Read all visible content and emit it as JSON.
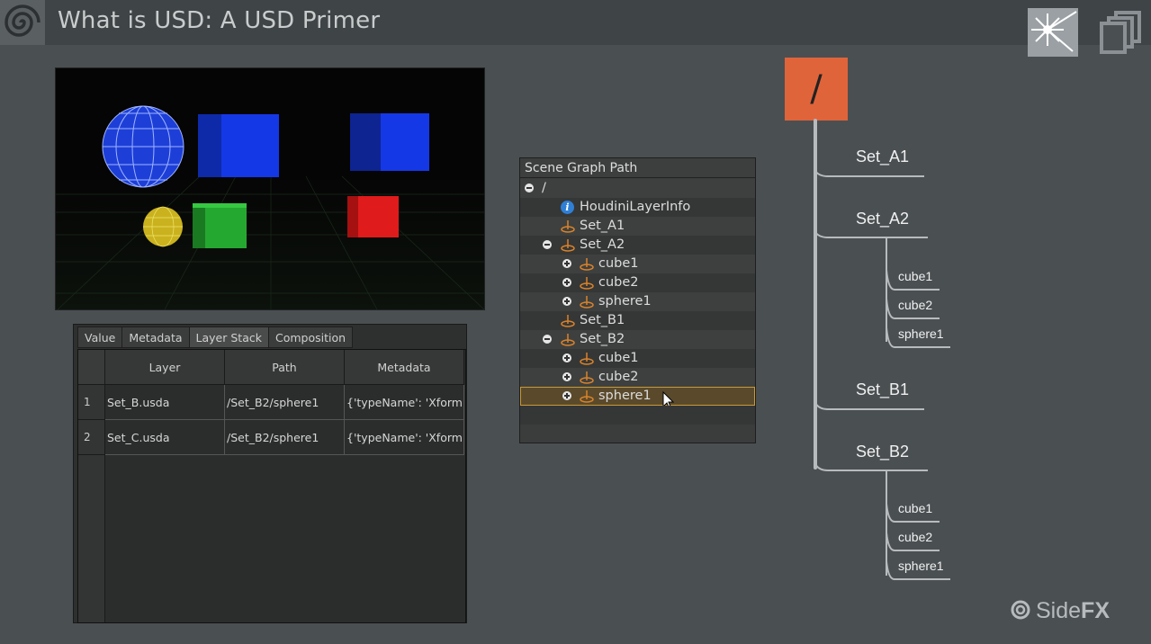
{
  "header": {
    "title": "What is USD: A USD Primer"
  },
  "details_panel": {
    "tabs": [
      "Value",
      "Metadata",
      "Layer Stack",
      "Composition"
    ],
    "active_tab": "Layer Stack",
    "columns": [
      "Layer",
      "Path",
      "Metadata"
    ],
    "rows": [
      {
        "index": "1",
        "layer": "Set_B.usda",
        "path": "/Set_B2/sphere1",
        "metadata": "{'typeName': 'Xform'}"
      },
      {
        "index": "2",
        "layer": "Set_C.usda",
        "path": "/Set_B2/sphere1",
        "metadata": "{'typeName': 'Xform'}"
      }
    ]
  },
  "scene_graph": {
    "header": "Scene Graph Path",
    "root": "/",
    "items": [
      {
        "label": "HoudiniLayerInfo"
      },
      {
        "label": "Set_A1"
      },
      {
        "label": "Set_A2"
      },
      {
        "label": "cube1"
      },
      {
        "label": "cube2"
      },
      {
        "label": "sphere1"
      },
      {
        "label": "Set_B1"
      },
      {
        "label": "Set_B2"
      },
      {
        "label": "cube1"
      },
      {
        "label": "cube2"
      },
      {
        "label": "sphere1"
      }
    ],
    "selected": "sphere1"
  },
  "hierarchy_diagram": {
    "root": "/",
    "nodes": [
      "Set_A1",
      "Set_A2",
      "Set_B1",
      "Set_B2"
    ],
    "set_a2_children": [
      "cube1",
      "cube2",
      "sphere1"
    ],
    "set_b2_children": [
      "cube1",
      "cube2",
      "sphere1"
    ]
  },
  "branding": {
    "logo_text_side": "Side",
    "logo_text_fx": "FX"
  },
  "colors": {
    "accent_root": "#e0643a",
    "selection": "#c79a3a"
  }
}
